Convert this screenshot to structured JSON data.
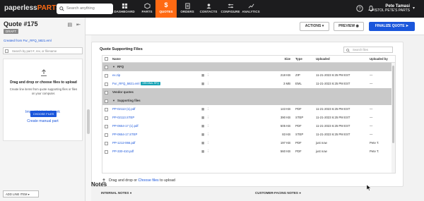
{
  "topbar": {
    "logo_text_1": "paperless",
    "logo_text_2": "PARTS",
    "search_placeholder": "Search anything",
    "nav": [
      {
        "label": "DASHBOARD",
        "icon": "dashboard-icon"
      },
      {
        "label": "PARTS",
        "icon": "parts-icon"
      },
      {
        "label": "QUOTES",
        "icon": "dollar-icon"
      },
      {
        "label": "ORDERS",
        "icon": "orders-icon"
      },
      {
        "label": "CONTACTS",
        "icon": "contacts-icon"
      },
      {
        "label": "CONFIGURE",
        "icon": "configure-icon"
      },
      {
        "label": "ANALYTICS",
        "icon": "analytics-icon"
      }
    ],
    "user_name": "Pete Tamasi",
    "user_company": "PISTOL PETE'S PARTS",
    "accent": "#ff6a13"
  },
  "sidebar": {
    "quote_title": "Quote #175",
    "status": "DRAFT",
    "created_prefix": "Created from ",
    "created_file": "Fw:_RFQ_5821.eml",
    "search_placeholder": "Search by part #, rev, or filename",
    "drop_title": "Drag and drop or choose files to upload",
    "drop_desc": "Create line items from quote supporting files or files on your computer.",
    "choose_button": "CHOOSE FILES",
    "import_link": "Import historical work",
    "create_link": "Create manual part",
    "add_line_item": "ADD LINE ITEM"
  },
  "header": {
    "actions": "ACTIONS",
    "preview": "PREVIEW",
    "finalize": "FINALIZE QUOTE"
  },
  "files": {
    "title": "Quote Supporting Files",
    "search_placeholder": "Search files",
    "columns": {
      "name": "Name",
      "size": "Size",
      "type": "Type",
      "uploaded": "Uploaded",
      "uploaded_by": "Uploaded by"
    },
    "group_rfq": "RFQ",
    "rfq_rows": [
      {
        "name": "ex.zip",
        "badge": "",
        "size": "218 KB",
        "type": "ZIP",
        "uploaded": "11-21-2023 6:25 PM EST",
        "by": "—"
      },
      {
        "name": "Fw:_RFQ_5821.eml",
        "badge": "ORIGINAL RFQ",
        "size": "3 MB",
        "type": "EML",
        "uploaded": "11-21-2023 6:25 PM EST",
        "by": "—"
      }
    ],
    "group_vendor": "Vendor quotes",
    "group_supporting": "Supporting files",
    "supporting_rows": [
      {
        "name": "PP-02113 (1).pdf",
        "size": "143 KB",
        "type": "PDF",
        "uploaded": "11-21-2023 6:25 PM EST",
        "by": "—"
      },
      {
        "name": "PP-02113.STEP",
        "size": "390 KB",
        "type": "STEP",
        "uploaded": "11-21-2023 6:25 PM EST",
        "by": "—"
      },
      {
        "name": "PP-0654-17 (1).pdf",
        "size": "505 KB",
        "type": "PDF",
        "uploaded": "11-21-2023 6:25 PM EST",
        "by": "—"
      },
      {
        "name": "PP-0654-17.STEP",
        "size": "83 KB",
        "type": "STEP",
        "uploaded": "11-21-2023 6:25 PM EST",
        "by": "—"
      },
      {
        "name": "PP-1212-066.pdf",
        "size": "197 KB",
        "type": "PDF",
        "uploaded": "just now",
        "by": "Pete T."
      },
      {
        "name": "PP-330-410.pdf",
        "size": "560 KB",
        "type": "PDF",
        "uploaded": "just now",
        "by": "Pete T."
      }
    ],
    "drop_text": "Drag and drop or ",
    "drop_link": "Choose files",
    "drop_suffix": " to upload"
  },
  "notes": {
    "title": "Notes",
    "internal": "INTERNAL NOTES",
    "customer": "CUSTOMER-FACING NOTES"
  }
}
